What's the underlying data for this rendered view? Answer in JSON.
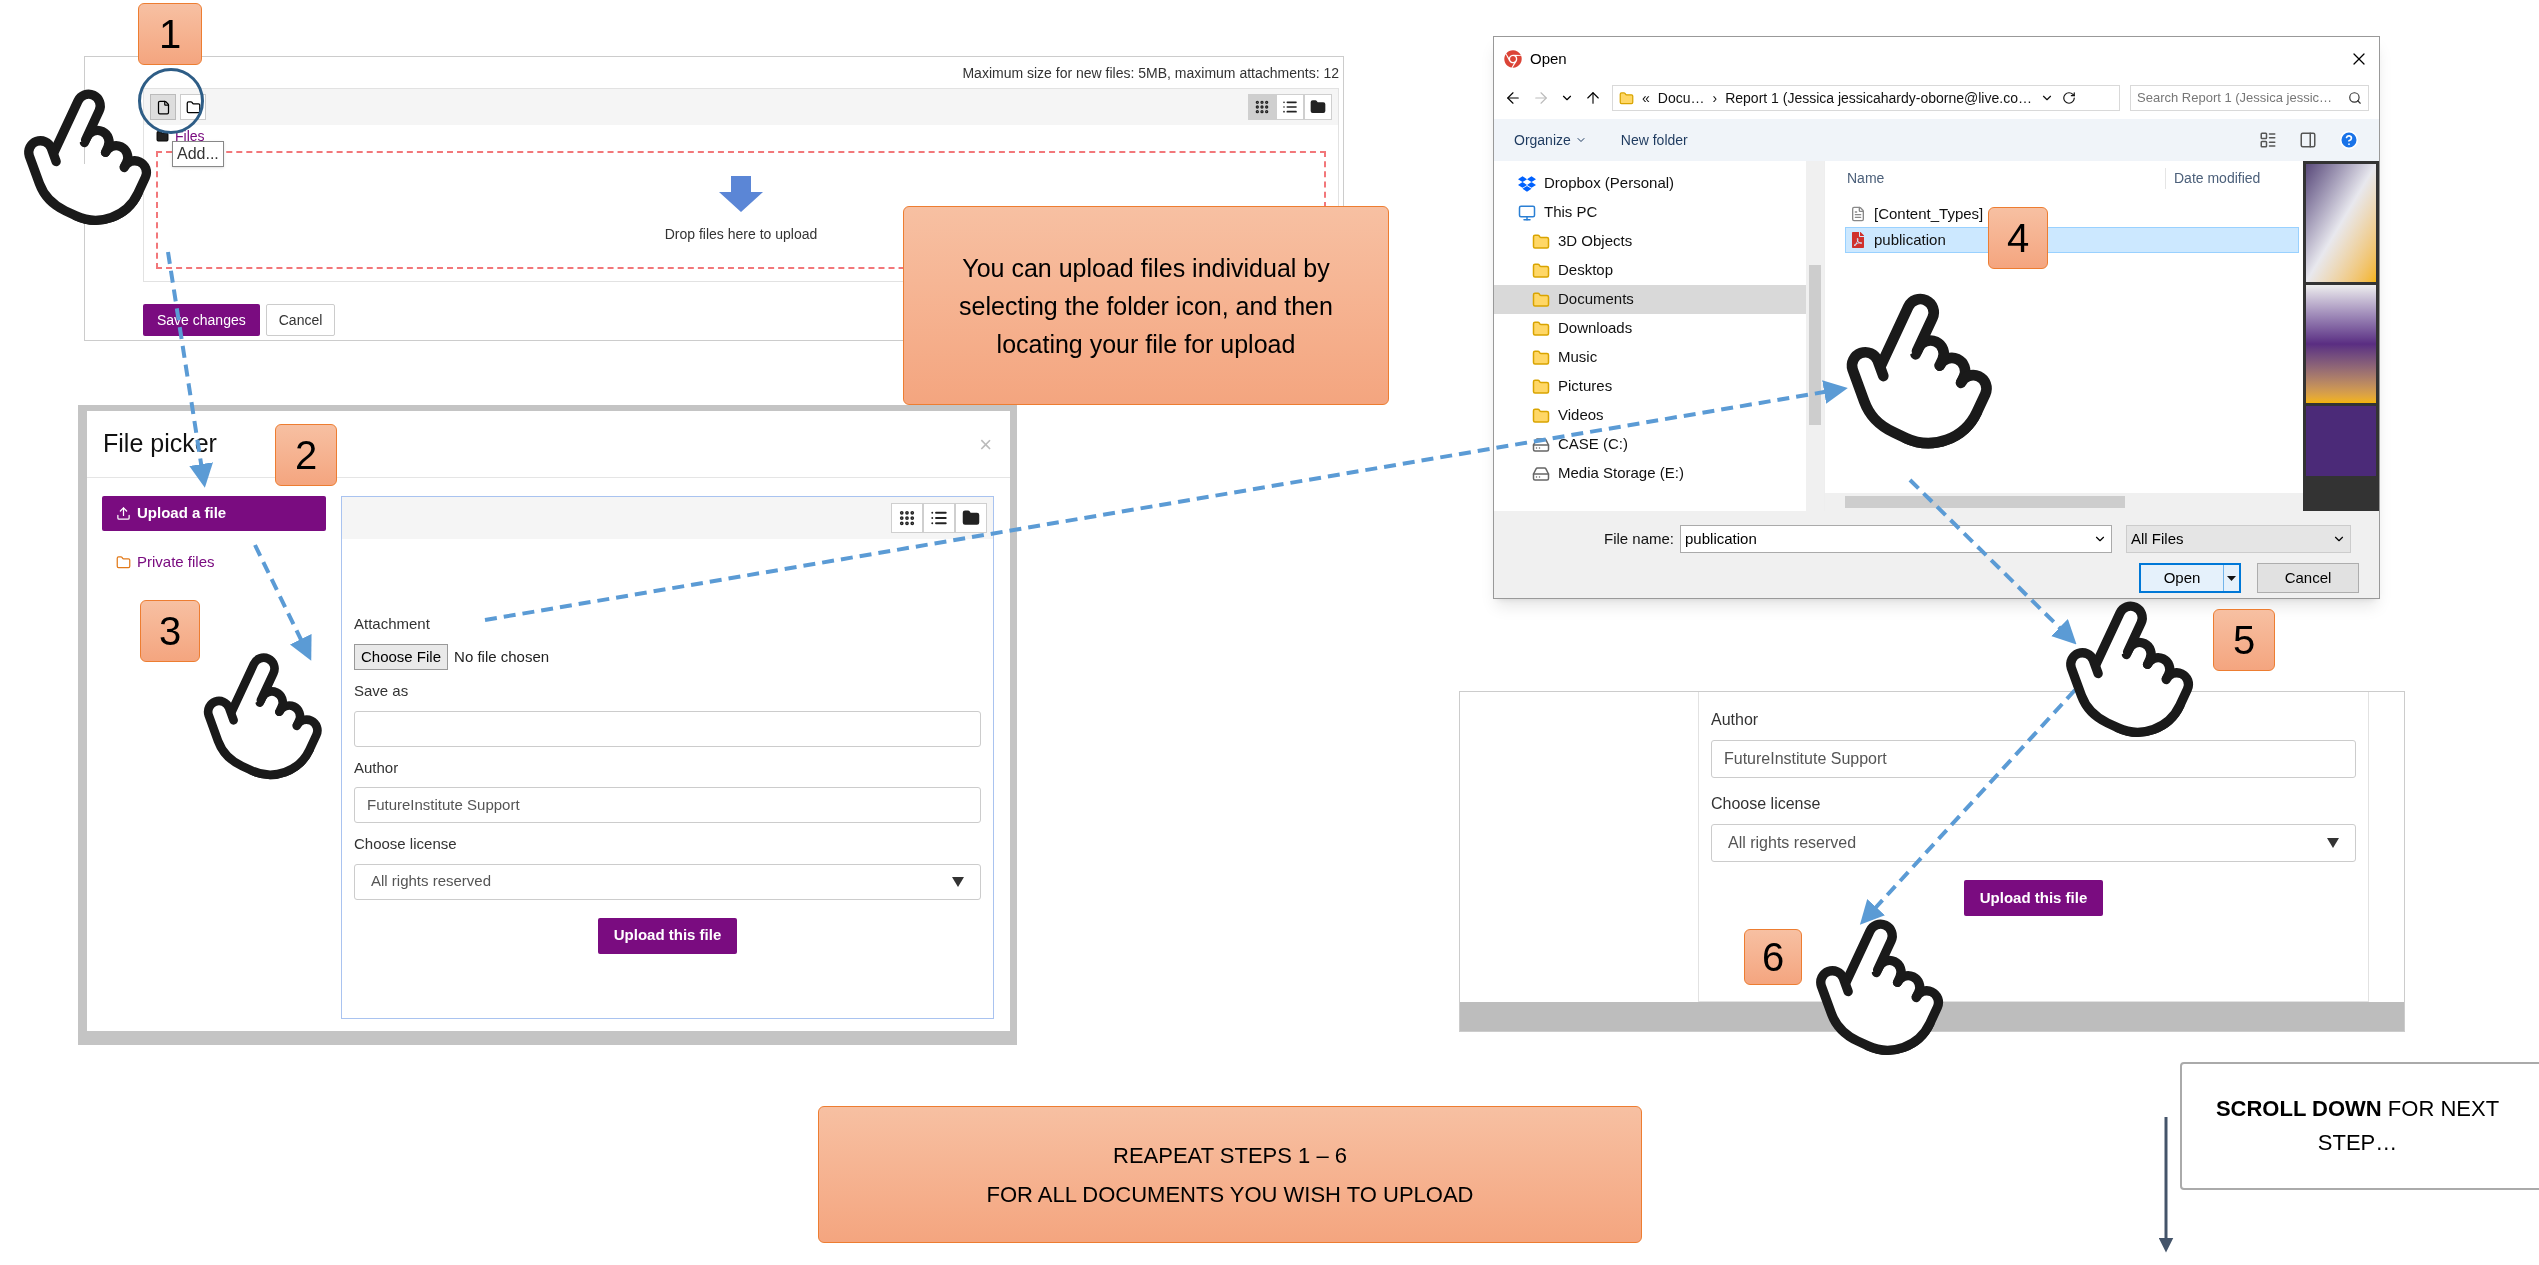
{
  "steps": [
    "1",
    "2",
    "3",
    "4",
    "5",
    "6"
  ],
  "upload_form": {
    "limits": "Maximum size for new files: 5MB, maximum attachments: 12",
    "view_buttons": [
      {
        "kind": "grid",
        "selected": true
      },
      {
        "kind": "list",
        "selected": false
      },
      {
        "kind": "tree",
        "selected": false
      }
    ],
    "path": "Files",
    "tooltip": "Add...",
    "drop_hint": "Drop files here to upload",
    "buttons": [
      {
        "label": "Save changes",
        "kind": "primary"
      },
      {
        "label": "Cancel",
        "kind": "secondary"
      }
    ]
  },
  "callout": "You can upload files individual by selecting the folder icon, and then locating your file for upload",
  "file_picker": {
    "title": "File picker",
    "close": "×",
    "sources": [
      {
        "label": "Upload a file",
        "selected": true
      },
      {
        "label": "Private files",
        "selected": false
      }
    ],
    "view_buttons": [
      {
        "kind": "grid",
        "selected": false
      },
      {
        "kind": "list",
        "selected": false
      },
      {
        "kind": "tree",
        "selected": false
      }
    ],
    "fields": [
      {
        "kind": "file",
        "label": "Attachment",
        "button": "Choose File",
        "value": "No file chosen"
      },
      {
        "kind": "text",
        "label": "Save as"
      },
      {
        "kind": "text",
        "label": "Author",
        "value": "FutureInstitute Support"
      },
      {
        "kind": "select",
        "label": "Choose license",
        "value": "All rights reserved"
      }
    ],
    "submit": "Upload this file"
  },
  "open_dialog": {
    "title": "Open",
    "address": [
      "«",
      "Docu…",
      "›",
      "Report 1 (Jessica jessicahardy-oborne@live.co…"
    ],
    "search_placeholder": "Search Report 1 (Jessica jessic…",
    "toolbar": [
      "Organize",
      "New folder"
    ],
    "tree": [
      {
        "label": "Dropbox (Personal)",
        "kind": "dropbox",
        "selected": false
      },
      {
        "label": "This PC",
        "kind": "pc",
        "selected": false,
        "children": [
          {
            "label": "3D Objects",
            "kind": "folder",
            "selected": false
          },
          {
            "label": "Desktop",
            "kind": "folder",
            "selected": false
          },
          {
            "label": "Documents",
            "kind": "folder",
            "selected": true
          },
          {
            "label": "Downloads",
            "kind": "folder",
            "selected": false
          },
          {
            "label": "Music",
            "kind": "folder",
            "selected": false
          },
          {
            "label": "Pictures",
            "kind": "folder",
            "selected": false
          },
          {
            "label": "Videos",
            "kind": "folder",
            "selected": false
          },
          {
            "label": "CASE (C:)",
            "kind": "drive",
            "selected": false
          },
          {
            "label": "Media Storage (E:)",
            "kind": "drive",
            "selected": false
          }
        ]
      }
    ],
    "columns": [
      "Name",
      "Date modified"
    ],
    "files": [
      {
        "name": "[Content_Types]",
        "kind": "file",
        "selected": false
      },
      {
        "name": "publication",
        "kind": "pdf",
        "selected": true
      }
    ],
    "file_name_label": "File name:",
    "file_name": "publication",
    "file_type": "All Files",
    "buttons": [
      {
        "label": "Open",
        "kind": "primary"
      },
      {
        "label": "Cancel",
        "kind": "secondary"
      }
    ]
  },
  "upload_detail": {
    "fields": [
      {
        "kind": "text",
        "label": "Author",
        "value": "FutureInstitute Support"
      },
      {
        "kind": "select",
        "label": "Choose license",
        "value": "All rights reserved"
      }
    ],
    "submit": "Upload this file"
  },
  "repeat_note": [
    "REAPEAT STEPS 1 – 6",
    "FOR ALL DOCUMENTS YOU WISH TO UPLOAD"
  ],
  "scroll_note": "**SCROLL DOWN** FOR NEXT STEP…"
}
